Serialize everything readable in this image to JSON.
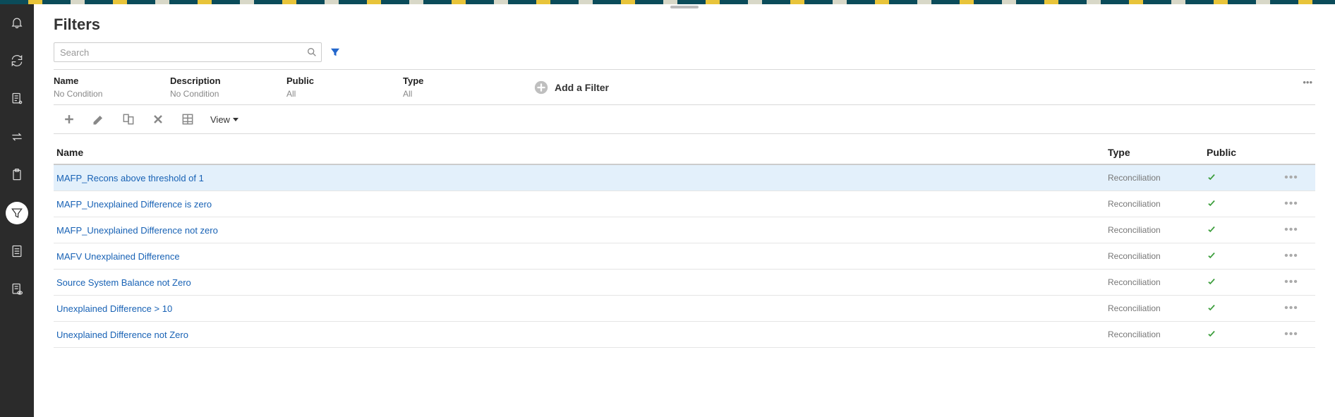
{
  "page": {
    "title": "Filters"
  },
  "search": {
    "placeholder": "Search"
  },
  "filter_criteria": [
    {
      "label": "Name",
      "value": "No Condition"
    },
    {
      "label": "Description",
      "value": "No Condition"
    },
    {
      "label": "Public",
      "value": "All"
    },
    {
      "label": "Type",
      "value": "All"
    }
  ],
  "add_filter": {
    "label": "Add a Filter"
  },
  "toolbar": {
    "view_label": "View"
  },
  "columns": {
    "name": "Name",
    "type": "Type",
    "public": "Public"
  },
  "rows": [
    {
      "name": "MAFP_Recons above threshold of 1",
      "type": "Reconciliation",
      "public": true,
      "selected": true
    },
    {
      "name": "MAFP_Unexplained Difference is zero",
      "type": "Reconciliation",
      "public": true,
      "selected": false
    },
    {
      "name": "MAFP_Unexplained Difference not zero",
      "type": "Reconciliation",
      "public": true,
      "selected": false
    },
    {
      "name": "MAFV Unexplained Difference",
      "type": "Reconciliation",
      "public": true,
      "selected": false
    },
    {
      "name": "Source System Balance not Zero",
      "type": "Reconciliation",
      "public": true,
      "selected": false
    },
    {
      "name": "Unexplained Difference > 10",
      "type": "Reconciliation",
      "public": true,
      "selected": false
    },
    {
      "name": "Unexplained Difference not Zero",
      "type": "Reconciliation",
      "public": true,
      "selected": false
    }
  ]
}
